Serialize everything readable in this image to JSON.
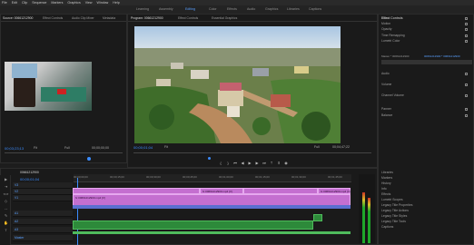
{
  "menu": [
    "File",
    "Edit",
    "Clip",
    "Sequence",
    "Markers",
    "Graphics",
    "View",
    "Window",
    "Help"
  ],
  "workspaces": [
    "Learning",
    "Assembly",
    "Editing",
    "Color",
    "Effects",
    "Audio",
    "Graphics",
    "Libraries",
    "Captions"
  ],
  "source_panel": {
    "tabs": [
      "Source: 00661212900",
      "Effect Controls",
      "Audio Clip Mixer",
      "Metadata"
    ],
    "timecode": "00;03;23;13",
    "fit_label": "Fit",
    "duration": "00;00;00;00",
    "zoom": "Full"
  },
  "program_panel": {
    "tabs": [
      "Program: 00661212900",
      "Effect Controls",
      "Essential Graphics"
    ],
    "timecode": "00;00;01;04",
    "fit_label": "Fit",
    "zoom": "Full",
    "duration": "00;04;47;22"
  },
  "effect_controls": {
    "title": "Effect Controls",
    "source": "Master * 00661212900",
    "sequence": "00661212900 * 00661212900",
    "sections": [
      "Video",
      "Motion",
      "Opacity",
      "Time Remapping",
      "Lumetri Color",
      "Audio",
      "Volume",
      "Channel Volume",
      "Panner",
      "Balance"
    ],
    "rows": [
      {
        "label": "Motion",
        "value": ""
      },
      {
        "label": "Position",
        "value": ""
      },
      {
        "label": "Scale",
        "value": ""
      },
      {
        "label": "Rotation",
        "value": ""
      },
      {
        "label": "Opacity",
        "value": ""
      },
      {
        "label": "Blend Mode",
        "value": ""
      }
    ],
    "lower_items": [
      "Libraries",
      "Markers",
      "History",
      "Info",
      "Effects",
      "Lumetri Scopes",
      "Legacy Title Properties",
      "Legacy Title Actions",
      "Legacy Title Styles",
      "Legacy Title Tools",
      "Captions"
    ]
  },
  "timeline": {
    "tab": "00661212900",
    "timecode": "00;00;01;04",
    "ruler_times": [
      "00;00;00;00",
      "00;00;15;00",
      "00;00;30;00",
      "00;00;45;00",
      "00;01;00;00",
      "00;01;15;00",
      "00;01;30;00",
      "00;01;45;00"
    ],
    "tracks": [
      {
        "name": "V3"
      },
      {
        "name": "V2"
      },
      {
        "name": "V1"
      },
      {
        "name": "A1"
      },
      {
        "name": "A2"
      },
      {
        "name": "A3"
      },
      {
        "name": "Master"
      }
    ],
    "clips": [
      {
        "label": "fx 00661212900.mp4 [V]",
        "track": "V2"
      },
      {
        "label": "fx 00661212900.mp4 [V]",
        "track": "V2"
      },
      {
        "label": "fx 00661212900.mp4 [V]",
        "track": "V1"
      }
    ]
  },
  "colors": {
    "accent": "#3b8cff",
    "video_clip": "#c46fd0",
    "audio_clip": "#2d8a3a",
    "playhead": "#3b8cff"
  }
}
